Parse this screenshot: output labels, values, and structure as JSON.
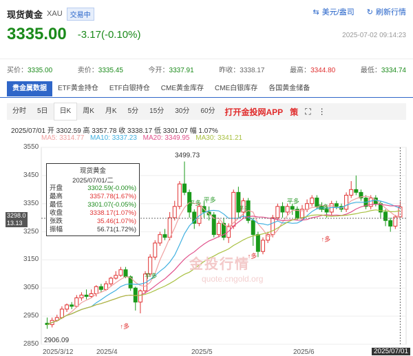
{
  "header": {
    "title": "现货黄金",
    "code": "XAU",
    "status": "交易中",
    "currency": "美元/盎司",
    "refresh": "刷新行情",
    "price": "3335.00",
    "change": "-3.17(-0.10%)",
    "timestamp": "2025-07-02 09:14:23"
  },
  "quote": [
    {
      "label": "买价",
      "value": "3335.00",
      "tone": "dn"
    },
    {
      "label": "卖价",
      "value": "3335.45",
      "tone": "dn"
    },
    {
      "label": "今开",
      "value": "3337.91",
      "tone": "dn"
    },
    {
      "label": "昨收",
      "value": "3338.17",
      "tone": ""
    },
    {
      "label": "最高",
      "value": "3344.80",
      "tone": "up"
    },
    {
      "label": "最低",
      "value": "3334.74",
      "tone": "dn"
    }
  ],
  "tabs": [
    "贵金属数据",
    "ETF黄金持仓",
    "ETF白银持仓",
    "CME黄金库存",
    "CME白银库存",
    "各国黄金储备"
  ],
  "periods": [
    "分时",
    "5日",
    "日K",
    "周K",
    "月K",
    "5分",
    "15分",
    "30分",
    "60分"
  ],
  "period_active": "日K",
  "app_text": "打开金投网APP",
  "info_line": "2025/07/01  开 3302.59  高 3357.78  收 3338.17  低 3301.07  幅 1.07%",
  "ma": {
    "ma5": "MA5: 3314.77",
    "ma10": "MA10: 3337.23",
    "ma20": "MA20: 3349.95",
    "ma30": "MA30: 3341.21",
    "colors": {
      "ma5": "#f0a0a0",
      "ma10": "#40b0e0",
      "ma20": "#e0508a",
      "ma30": "#a8c040"
    }
  },
  "tooltip": {
    "title": "现货黄金",
    "date": "2025/07/01/二",
    "rows": [
      {
        "k": "开盘",
        "v": "3302.59(-0.00%)",
        "tone": "dn"
      },
      {
        "k": "最高",
        "v": "3357.78(1.67%)",
        "tone": "up"
      },
      {
        "k": "最低",
        "v": "3301.07(-0.05%)",
        "tone": "dn"
      },
      {
        "k": "收盘",
        "v": "3338.17(1.07%)",
        "tone": "up"
      },
      {
        "k": "张跌",
        "v": "35.46(1.07%)",
        "tone": "up"
      },
      {
        "k": "振幅",
        "v": "56.71(1.72%)",
        "tone": ""
      }
    ]
  },
  "cursor": {
    "price": "3298.0",
    "sub": "13.13"
  },
  "annotations": {
    "high": "3499.73",
    "low": "2906.09",
    "signals": [
      "平多",
      "平多",
      "平多",
      "平多",
      "平多",
      "平多",
      "多",
      "多",
      "多"
    ]
  },
  "watermark": {
    "text": "金投行情",
    "url": "quote.cngold.org"
  },
  "chart_data": {
    "type": "candlestick",
    "yticks": [
      3550,
      3450,
      3350,
      3250,
      3150,
      3050,
      2950,
      2850
    ],
    "ylim": [
      2850,
      3550
    ],
    "xticks": [
      "2025/3/12",
      "2025/4",
      "2025/5",
      "2025/6",
      "2025/07/01"
    ],
    "candles": [
      [
        2925,
        2920,
        2945,
        2905
      ],
      [
        2920,
        2935,
        2945,
        2910
      ],
      [
        2935,
        2945,
        2955,
        2930
      ],
      [
        2945,
        2975,
        2985,
        2940
      ],
      [
        2975,
        2990,
        2995,
        2965
      ],
      [
        2990,
        2985,
        3000,
        2975
      ],
      [
        2985,
        3015,
        3025,
        2980
      ],
      [
        3015,
        3025,
        3035,
        3005
      ],
      [
        3025,
        3020,
        3045,
        3010
      ],
      [
        3020,
        3030,
        3045,
        3015
      ],
      [
        3030,
        3055,
        3060,
        3020
      ],
      [
        3055,
        3045,
        3065,
        3035
      ],
      [
        3045,
        3065,
        3075,
        3040
      ],
      [
        3065,
        3085,
        3090,
        3055
      ],
      [
        3085,
        3095,
        3110,
        3080
      ],
      [
        3095,
        3115,
        3125,
        3090
      ],
      [
        3115,
        3090,
        3125,
        3085
      ],
      [
        3090,
        3050,
        3095,
        3040
      ],
      [
        3050,
        3000,
        3055,
        2970
      ],
      [
        3000,
        3040,
        3045,
        2960
      ],
      [
        3040,
        3100,
        3110,
        3030
      ],
      [
        3100,
        3160,
        3170,
        3090
      ],
      [
        3160,
        3210,
        3220,
        3150
      ],
      [
        3210,
        3240,
        3250,
        3200
      ],
      [
        3240,
        3230,
        3260,
        3220
      ],
      [
        3230,
        3300,
        3320,
        3220
      ],
      [
        3300,
        3340,
        3360,
        3290
      ],
      [
        3340,
        3420,
        3430,
        3330
      ],
      [
        3420,
        3390,
        3499.73,
        3380
      ],
      [
        3390,
        3320,
        3400,
        3300
      ],
      [
        3320,
        3280,
        3330,
        3260
      ],
      [
        3280,
        3340,
        3350,
        3270
      ],
      [
        3340,
        3320,
        3360,
        3300
      ],
      [
        3320,
        3310,
        3340,
        3290
      ],
      [
        3310,
        3240,
        3320,
        3230
      ],
      [
        3240,
        3280,
        3290,
        3230
      ],
      [
        3280,
        3230,
        3300,
        3220
      ],
      [
        3230,
        3270,
        3280,
        3210
      ],
      [
        3270,
        3390,
        3400,
        3260
      ],
      [
        3390,
        3320,
        3410,
        3300
      ],
      [
        3320,
        3360,
        3370,
        3300
      ],
      [
        3360,
        3290,
        3370,
        3280
      ],
      [
        3290,
        3240,
        3300,
        3200
      ],
      [
        3240,
        3180,
        3250,
        3160
      ],
      [
        3180,
        3220,
        3230,
        3170
      ],
      [
        3220,
        3240,
        3250,
        3210
      ],
      [
        3240,
        3300,
        3310,
        3230
      ],
      [
        3300,
        3340,
        3350,
        3290
      ],
      [
        3340,
        3320,
        3355,
        3300
      ],
      [
        3320,
        3340,
        3350,
        3310
      ],
      [
        3340,
        3330,
        3350,
        3310
      ],
      [
        3330,
        3300,
        3340,
        3290
      ],
      [
        3300,
        3330,
        3345,
        3290
      ],
      [
        3330,
        3350,
        3365,
        3320
      ],
      [
        3350,
        3370,
        3380,
        3340
      ],
      [
        3370,
        3340,
        3380,
        3330
      ],
      [
        3340,
        3330,
        3355,
        3320
      ],
      [
        3330,
        3320,
        3340,
        3300
      ],
      [
        3320,
        3350,
        3360,
        3310
      ],
      [
        3350,
        3340,
        3360,
        3330
      ],
      [
        3340,
        3330,
        3350,
        3320
      ],
      [
        3330,
        3380,
        3390,
        3320
      ],
      [
        3380,
        3400,
        3430,
        3370
      ],
      [
        3400,
        3390,
        3450,
        3380
      ],
      [
        3390,
        3370,
        3400,
        3360
      ],
      [
        3370,
        3340,
        3380,
        3330
      ],
      [
        3340,
        3370,
        3380,
        3330
      ],
      [
        3370,
        3350,
        3380,
        3340
      ],
      [
        3350,
        3320,
        3360,
        3300
      ],
      [
        3320,
        3290,
        3330,
        3270
      ],
      [
        3290,
        3270,
        3300,
        3250
      ],
      [
        3270,
        3302.59,
        3310,
        3260
      ],
      [
        3302.59,
        3338.17,
        3357.78,
        3301.07
      ]
    ]
  }
}
